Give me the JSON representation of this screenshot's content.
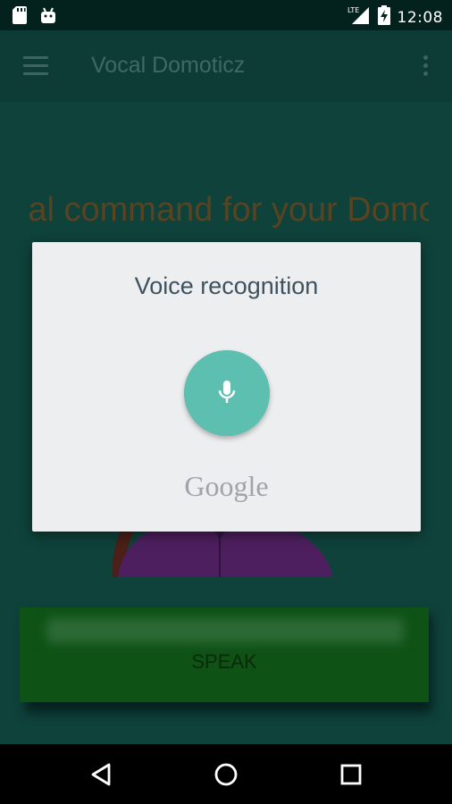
{
  "status_bar": {
    "time": "12:08",
    "network_label": "LTE",
    "icons": [
      "sd-card-icon",
      "android-icon",
      "lte-signal-icon",
      "battery-charging-icon"
    ]
  },
  "app_bar": {
    "title": "Vocal Domoticz",
    "icons": [
      "menu-icon",
      "overflow-icon"
    ]
  },
  "main": {
    "headline": "Vocal command for your Domoticz",
    "speak_label": "SPEAK"
  },
  "dialog": {
    "title": "Voice recognition",
    "mic_icon": "microphone-icon",
    "brand": "Google"
  },
  "nav_bar": {
    "icons": [
      "back-icon",
      "home-icon",
      "recents-icon"
    ]
  },
  "colors": {
    "mic_button": "#5cbfb0",
    "dialog_background": "#eceef0",
    "speak_button": "#0e5216",
    "headline_text": "#5a4320",
    "status_bar": "#03211d",
    "app_bar": "#0d3b36",
    "content_background": "#0f423b"
  }
}
